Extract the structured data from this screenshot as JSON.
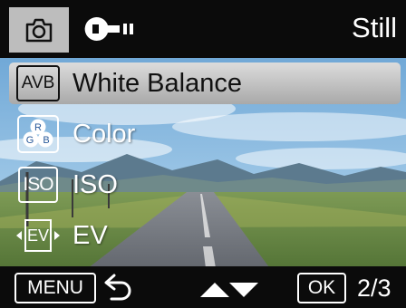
{
  "header": {
    "camera_tab_icon": "camera-icon",
    "setup_tab_icon": "wrench-icon",
    "mode_label": "Still"
  },
  "menu": {
    "items": [
      {
        "icon_text": "AVB",
        "icon": "white-balance-icon",
        "label": "White Balance",
        "selected": true
      },
      {
        "icon": "color-rgb-icon",
        "icon_letters": [
          "R",
          "G",
          "B"
        ],
        "label": "Color",
        "selected": false
      },
      {
        "icon_text": "ISO",
        "icon": "iso-icon",
        "label": "ISO",
        "selected": false
      },
      {
        "icon_text": "EV",
        "icon": "ev-icon",
        "label": "EV",
        "selected": false
      }
    ]
  },
  "footer": {
    "menu_key": "MENU",
    "back_icon": "back-arrow-icon",
    "nav_icons": [
      "up-arrow-icon",
      "down-arrow-icon"
    ],
    "ok_key": "OK",
    "page_indicator": "2/3"
  },
  "colors": {
    "bar_background": "#0b0b0b",
    "highlight": "#c4c4c4",
    "text": "#ffffff",
    "sky": "#7fb2dc"
  }
}
